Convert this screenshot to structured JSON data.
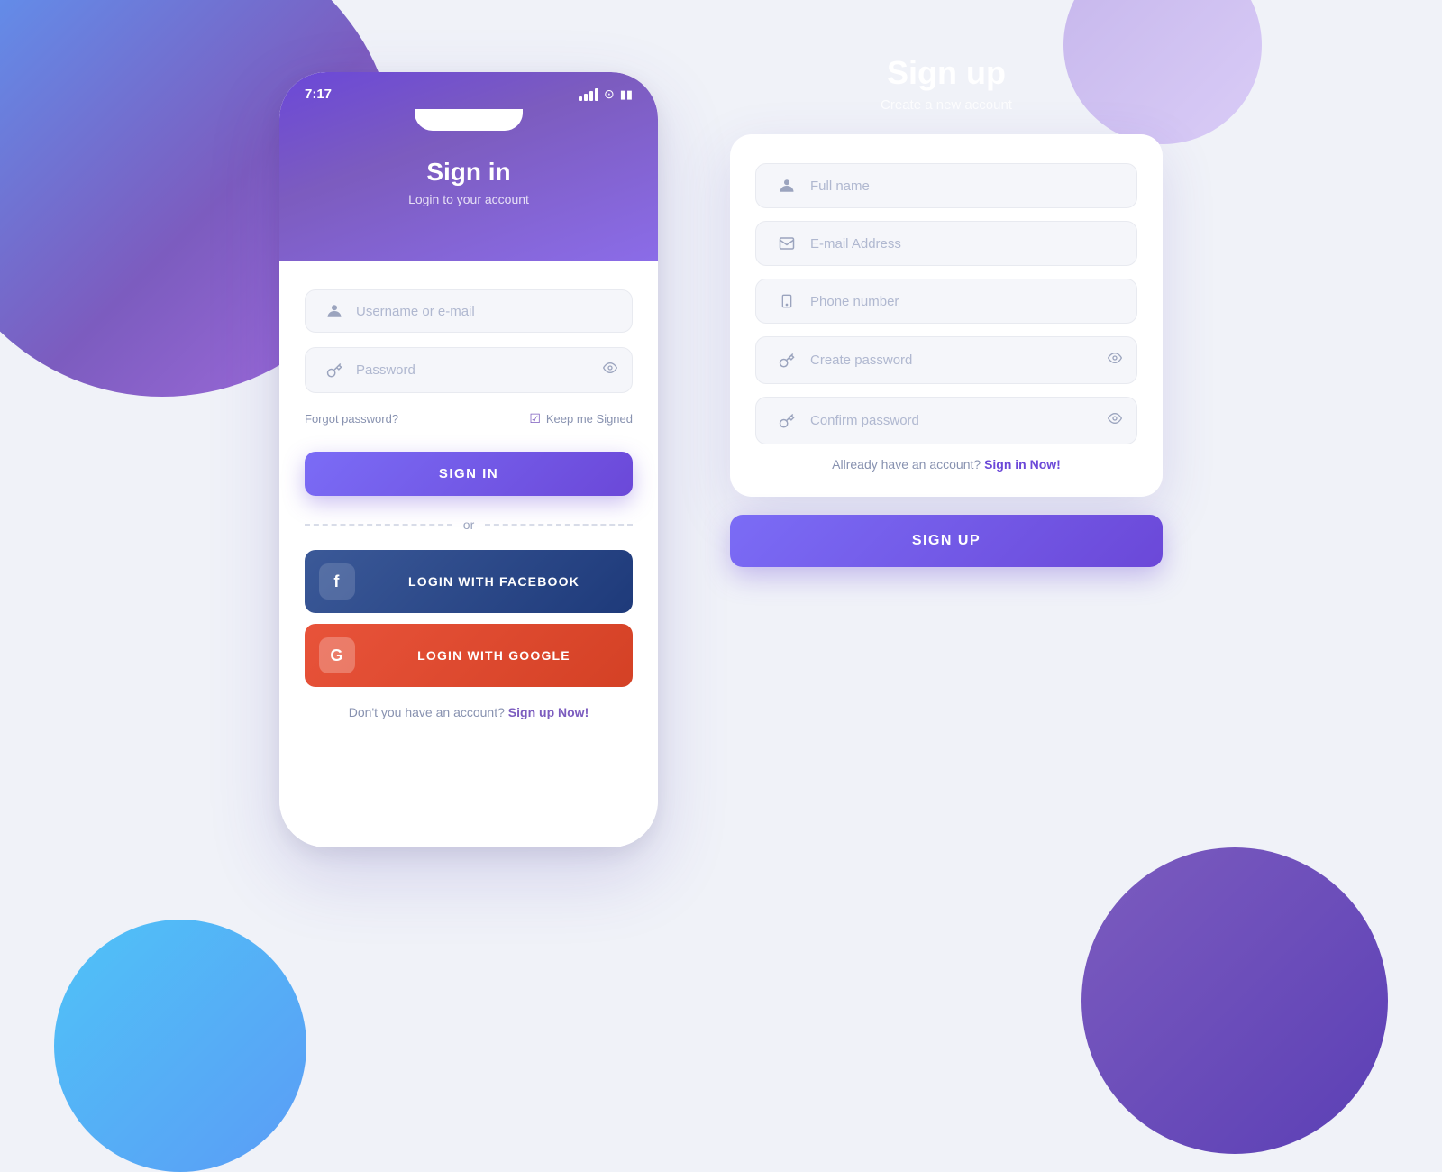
{
  "background": {
    "color": "#f0f2f8"
  },
  "signin": {
    "status_time": "7:17",
    "title": "Sign in",
    "subtitle": "Login to your account",
    "username_placeholder": "Username or e-mail",
    "password_placeholder": "Password",
    "forgot_password": "Forgot password?",
    "keep_signed_label": "Keep me Signed",
    "signin_button": "SIGN IN",
    "or_text": "or",
    "facebook_button": "LOGIN WITH FACEBOOK",
    "google_button": "LOGIN WITH GOOGLE",
    "footer_text": "Don't you have an account?",
    "footer_link": "Sign up Now!"
  },
  "signup": {
    "title": "Sign up",
    "subtitle": "Create a new account",
    "fullname_placeholder": "Full name",
    "email_placeholder": "E-mail Address",
    "phone_placeholder": "Phone number",
    "create_password_placeholder": "Create password",
    "confirm_password_placeholder": "Confirm password",
    "already_text": "Allready have an account?",
    "already_link": "Sign in Now!",
    "signup_button": "SIGN UP"
  }
}
